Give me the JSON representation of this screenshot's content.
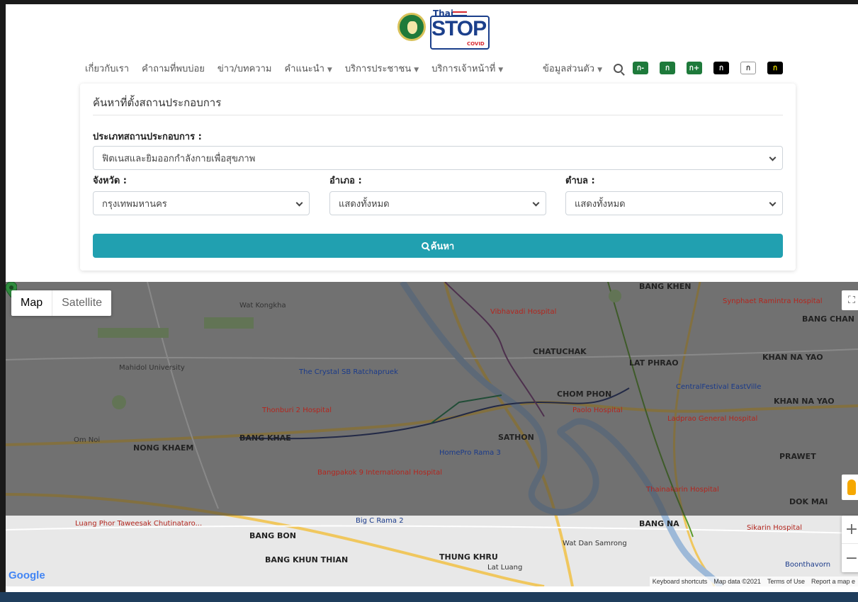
{
  "header": {
    "logo": {
      "brand_small": "Thai",
      "brand_big": "STOP",
      "brand_sub": "COVID"
    },
    "nav": [
      {
        "label": "เกี่ยวกับเรา",
        "dropdown": false
      },
      {
        "label": "คำถามที่พบบ่อย",
        "dropdown": false
      },
      {
        "label": "ข่าว/บทความ",
        "dropdown": false
      },
      {
        "label": "คำแนะนำ",
        "dropdown": true
      },
      {
        "label": "บริการประชาชน",
        "dropdown": true
      },
      {
        "label": "บริการเจ้าหน้าที่",
        "dropdown": true
      }
    ],
    "profile_label": "ข้อมูลส่วนตัว",
    "font_buttons": [
      {
        "label": "ก-",
        "bg": "#1e7a3b",
        "fg": "#ffffff"
      },
      {
        "label": "ก",
        "bg": "#1e7a3b",
        "fg": "#ffffff"
      },
      {
        "label": "ก+",
        "bg": "#1e7a3b",
        "fg": "#ffffff"
      },
      {
        "label": "ก",
        "bg": "#000000",
        "fg": "#ffffff"
      },
      {
        "label": "ก",
        "bg": "#ffffff",
        "fg": "#333333"
      },
      {
        "label": "ก",
        "bg": "#000000",
        "fg": "#f2e600"
      }
    ]
  },
  "search_form": {
    "title": "ค้นหาที่ตั้งสถานประกอบการ",
    "business_type_label": "ประเภทสถานประกอบการ :",
    "business_type_value": "ฟิตเนสและยิมออกกำลังกายเพื่อสุขภาพ",
    "province_label": "จังหวัด :",
    "province_value": "กรุงเทพมหานคร",
    "district_label": "อำเภอ :",
    "district_value": "แสดงทั้งหมด",
    "subdistrict_label": "ตำบล :",
    "subdistrict_value": "แสดงทั้งหมด",
    "search_button": "ค้นหา"
  },
  "map": {
    "type_map": "Map",
    "type_satellite": "Satellite",
    "google": "Google",
    "attribution": [
      "Keyboard shortcuts",
      "Map data ©2021",
      "Terms of Use",
      "Report a map e"
    ],
    "labels": {
      "chatuchak": "CHATUCHAK",
      "lat_phrao": "LAT PHRAO",
      "khan_na_yao": "KHAN NA YAO",
      "chom_phon": "CHOM PHON",
      "sathon": "SATHON",
      "bang_khae": "BANG KHAE",
      "nong_khaem": "NONG KHAEM",
      "prawet": "PRAWET",
      "dok_mai": "DOK MAI",
      "bang_na": "BANG NA",
      "bang_bon": "BANG BON",
      "bang_khun_thian": "BANG KHUN THIAN",
      "thung_khru": "THUNG KHRU",
      "bang_khen": "BANG KHEN",
      "bang_chan": "BANG CHAN",
      "om_noi": "Om Noi",
      "wat_kongkha": "Wat Kongkha",
      "mahidol": "Mahidol University",
      "crystal_sb": "The Crystal SB Ratchapruek",
      "thonburi2": "Thonburi 2 Hospital",
      "vibhavadi": "Vibhavadi Hospital",
      "synphaet": "Synphaet Ramintra Hospital",
      "central_eastville": "CentralFestival EastVille",
      "paolo": "Paolo Hospital",
      "ladprao": "Ladprao General Hospital",
      "homepro": "HomePro Rama 3",
      "bangpakok": "Bangpakok 9 International Hospital",
      "thainakarin": "Thainakarin Hospital",
      "big_c": "Big C Rama 2",
      "sikarin": "Sikarin Hospital",
      "wat_dan": "Wat Dan Samrong",
      "luang_phor": "Luang Phor Taweesak Chutinataro...",
      "lat_luang": "Lat Luang",
      "boonthavorn": "Boonthavorn"
    }
  }
}
